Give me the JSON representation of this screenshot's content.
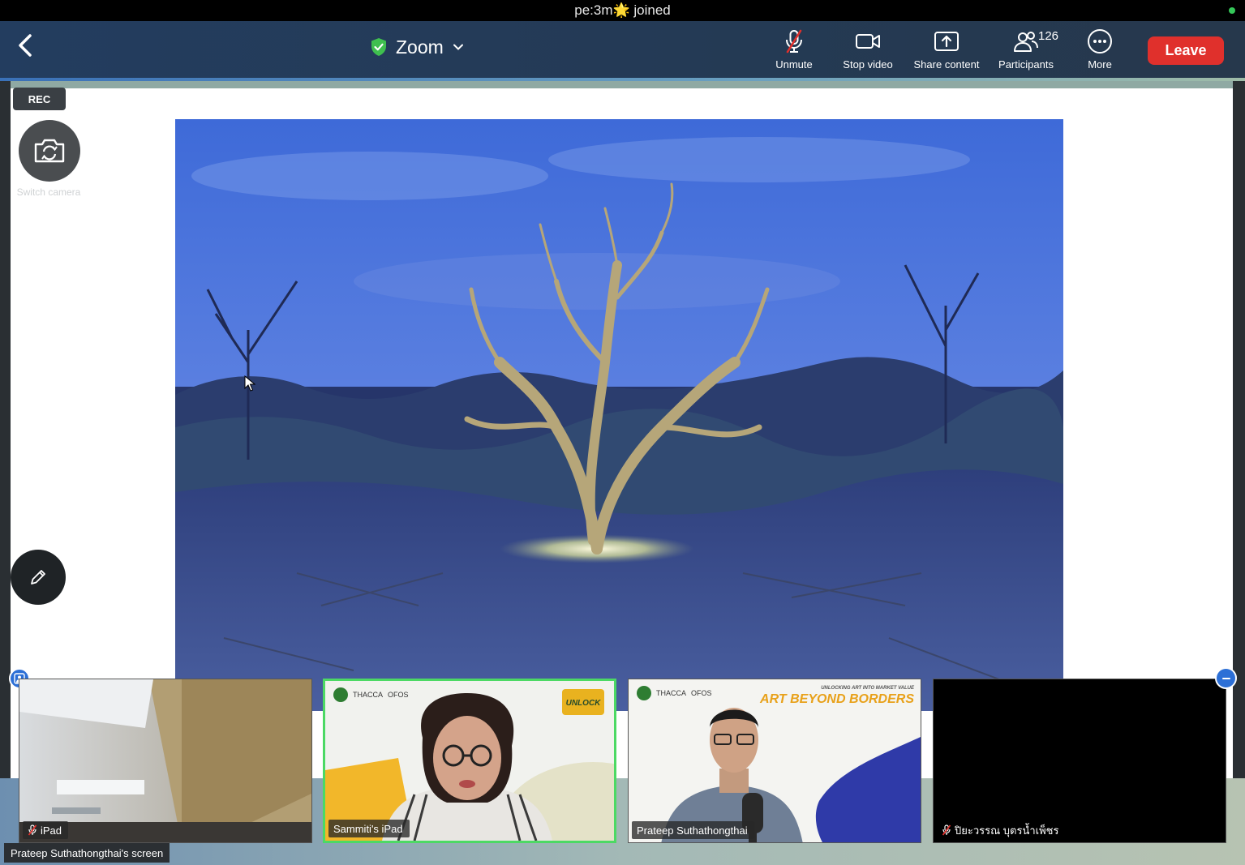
{
  "status_bar": {
    "text": "pe:3m🌟 joined"
  },
  "colors": {
    "leave": "#e0302c",
    "active_speaker": "#4cd964",
    "accent": "#2c6fd6",
    "secure": "#3fbf4f"
  },
  "header": {
    "meeting_title": "Zoom",
    "icons": {
      "back": "chevron-left-icon",
      "secure": "shield-check-icon",
      "dropdown": "chevron-down-icon"
    }
  },
  "toolbar": {
    "unmute_label": "Unmute",
    "stop_video_label": "Stop video",
    "share_content_label": "Share content",
    "participants_label": "Participants",
    "participants_count": "126",
    "more_label": "More",
    "leave_label": "Leave"
  },
  "overlay": {
    "rec_label": "REC",
    "switch_camera_label": "Switch camera",
    "icons": {
      "switch_camera": "camera-rotate-icon",
      "annotate": "pencil-icon",
      "pointer": "cursor-icon"
    }
  },
  "gallery": {
    "tiles": [
      {
        "name": "iPad",
        "muted": true
      },
      {
        "name": "Sammiti's iPad",
        "muted": false,
        "active": true,
        "banner_logos": [
          "THACCA",
          "OFOS"
        ]
      },
      {
        "name": "Prateep Suthathongthai",
        "muted": false,
        "banner_logos": [
          "THACCA",
          "OFOS"
        ],
        "banner_sub": "UNLOCKING ART INTO MARKET VALUE",
        "banner_title": "ART BEYOND BORDERS"
      },
      {
        "name": "ปิยะวรรณ บุตรน้ำเพ็ชร",
        "muted": true
      }
    ],
    "screen_label": "Prateep Suthathongthai's screen"
  }
}
